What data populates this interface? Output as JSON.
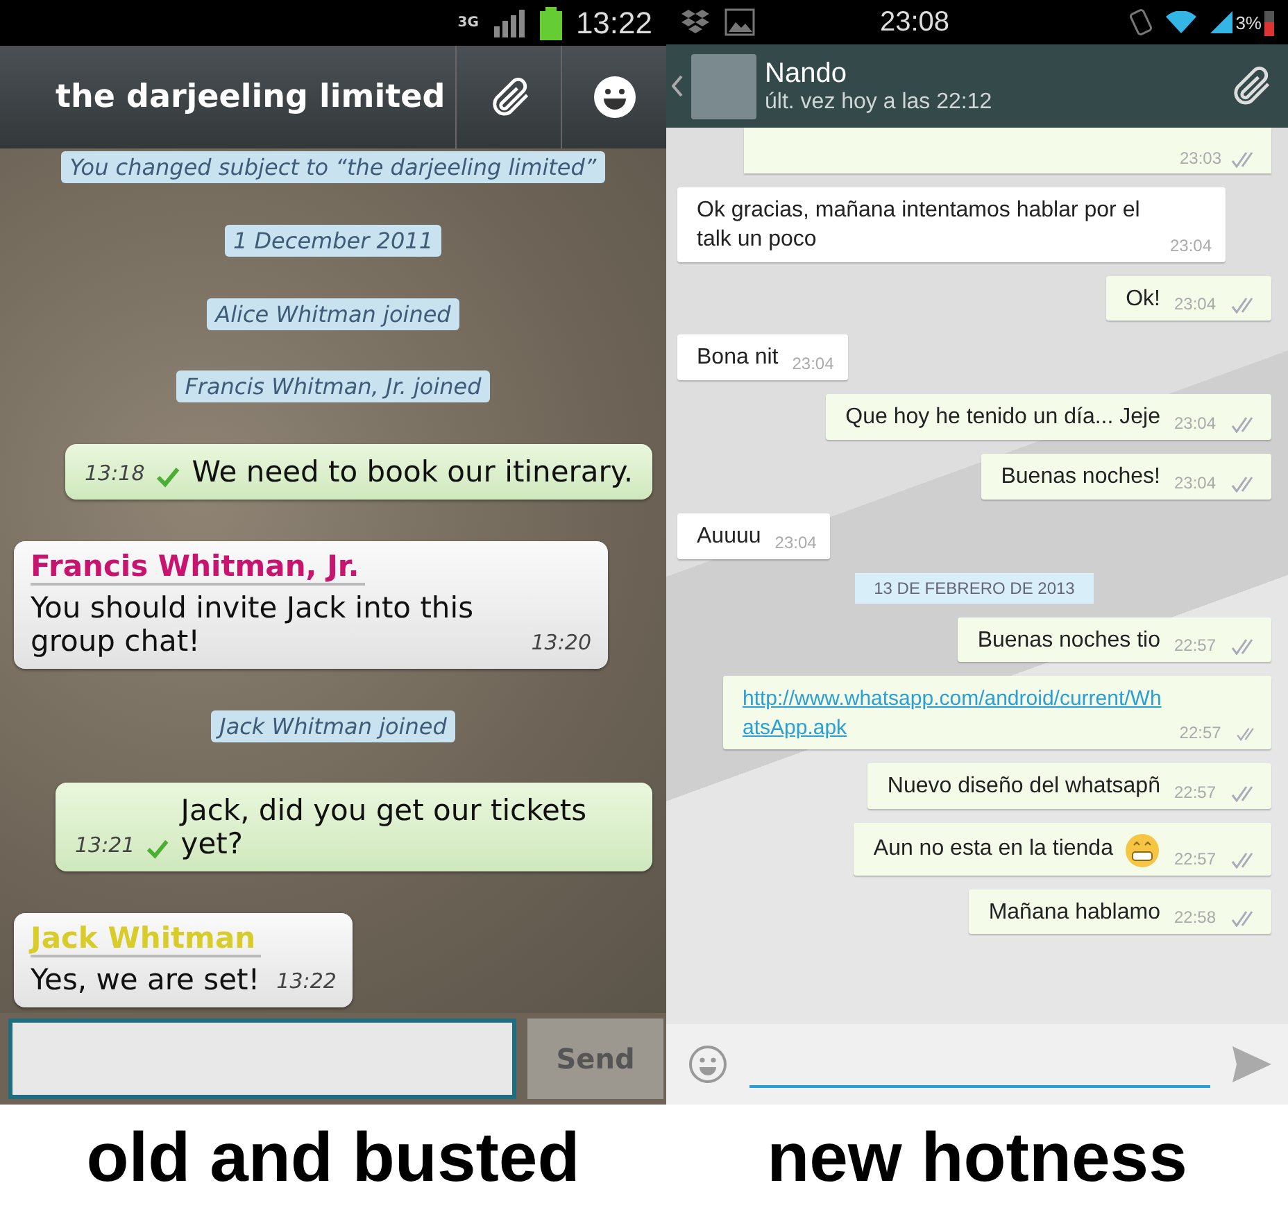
{
  "old_app": {
    "status_bar": {
      "network": "3G",
      "time": "13:22"
    },
    "header": {
      "title": "the darjeeling limited"
    },
    "messages": [
      {
        "kind": "notice",
        "text": "You changed subject to “the darjeeling limited”"
      },
      {
        "kind": "notice",
        "text": "1 December 2011"
      },
      {
        "kind": "notice",
        "text": "Alice Whitman joined"
      },
      {
        "kind": "notice",
        "text": "Francis Whitman, Jr. joined"
      },
      {
        "kind": "out",
        "text": "We need to book our itinerary.",
        "time": "13:18"
      },
      {
        "kind": "in",
        "sender": "Francis Whitman, Jr.",
        "color": "#c8146e",
        "text": "You should invite Jack into this group chat!",
        "time": "13:20"
      },
      {
        "kind": "notice",
        "text": "Jack Whitman joined"
      },
      {
        "kind": "out",
        "text": "Jack, did you get our tickets yet?",
        "time": "13:21"
      },
      {
        "kind": "in",
        "sender": "Jack Whitman",
        "color": "#d8cc2a",
        "text": "Yes, we are set!",
        "time": "13:22"
      }
    ],
    "composer": {
      "button": "Send"
    }
  },
  "new_app": {
    "status_bar": {
      "time": "23:08",
      "battery": "3%"
    },
    "header": {
      "name": "Nando",
      "last_seen": "últ. vez hoy a las 22:12"
    },
    "messages": [
      {
        "kind": "cut",
        "time": "23:03"
      },
      {
        "kind": "in",
        "text": "Ok gracias, mañana intentamos hablar por el talk un poco",
        "time": "23:04"
      },
      {
        "kind": "out",
        "text": "Ok!",
        "time": "23:04"
      },
      {
        "kind": "in",
        "text": "Bona nit",
        "time": "23:04"
      },
      {
        "kind": "out",
        "text": "Que hoy he tenido un día... Jeje",
        "time": "23:04"
      },
      {
        "kind": "out",
        "text": "Buenas noches!",
        "time": "23:04"
      },
      {
        "kind": "in",
        "text": "Auuuu",
        "time": "23:04"
      },
      {
        "kind": "date",
        "text": "13 DE FEBRERO DE 2013"
      },
      {
        "kind": "out",
        "text": "Buenas noches tio",
        "time": "22:57"
      },
      {
        "kind": "link",
        "text": "http://www.whatsapp.com/android/current/WhatsApp.apk",
        "time": "22:57"
      },
      {
        "kind": "out",
        "text": "Nuevo diseño del whatsapñ",
        "time": "22:57"
      },
      {
        "kind": "out",
        "text": "Aun no esta en la tienda",
        "emoji": true,
        "time": "22:57"
      },
      {
        "kind": "out",
        "text": "Mañana hablamo",
        "time": "22:58"
      }
    ]
  },
  "captions": [
    "old and busted",
    "new hotness"
  ]
}
